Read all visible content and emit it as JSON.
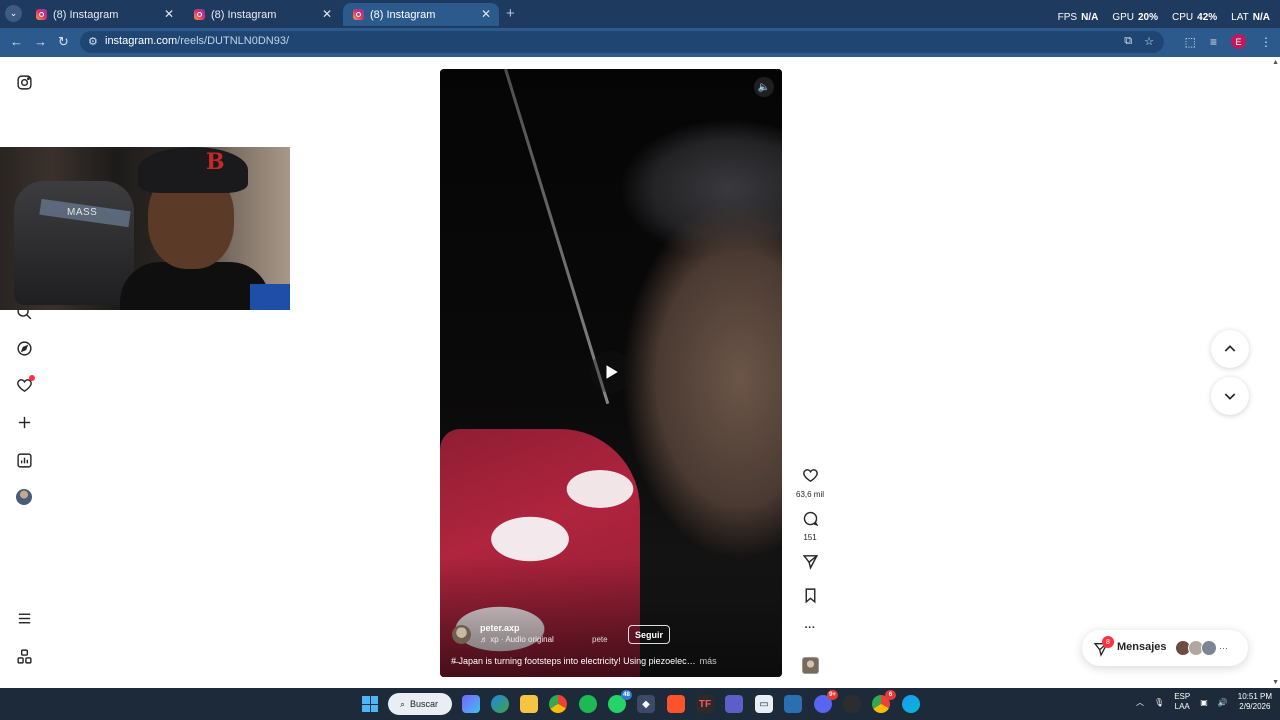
{
  "browser": {
    "tabs": [
      {
        "label": "(8) Instagram",
        "active": false
      },
      {
        "label": "(8) Instagram",
        "active": false
      },
      {
        "label": "(8) Instagram",
        "active": true
      }
    ],
    "new_tab": "+",
    "url_host": "instagram.com",
    "url_path": "/reels/DUTNLN0DN93/",
    "perf": {
      "fps_label": "FPS",
      "fps_value": "N/A",
      "gpu_label": "GPU",
      "gpu_value": "20%",
      "cpu_label": "CPU",
      "cpu_value": "42%",
      "lat_label": "LAT",
      "lat_value": "N/A"
    },
    "profile_initial": "E"
  },
  "webcam": {
    "chair_label": "MASS",
    "cap_logo": "B"
  },
  "reel": {
    "author": "peter.axp",
    "audio": "♬ xp · Audio original",
    "tagged": "pete",
    "follow_label": "Seguir",
    "caption": "#̶ Japan is turning footsteps into electricity! Using piezoelec…",
    "more_label": "más",
    "likes": "63,6 mil",
    "comments": "151",
    "more_icon": "···"
  },
  "messages": {
    "label": "Mensajes",
    "badge": "8",
    "more": "···"
  },
  "taskbar": {
    "search_label": "Buscar",
    "whatsapp_badge": "48",
    "discord_badge": "9+",
    "chrome_badge": "6",
    "lang_top": "ESP",
    "lang_bottom": "LAA",
    "time": "10:51 PM",
    "date": "2/9/2026"
  },
  "colors": {
    "chrome_dark": "#1f3a5f",
    "chrome_light": "#2c5a8c",
    "ig_red": "#ff3040",
    "taskbar": "#1c2a3a"
  }
}
